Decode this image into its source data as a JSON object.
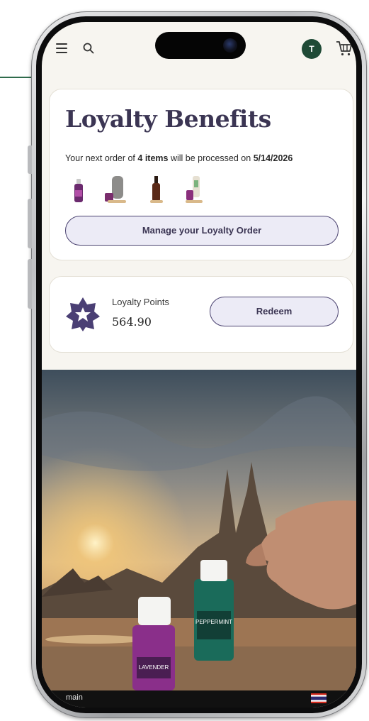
{
  "header": {
    "avatar_initial": "T"
  },
  "loyalty_benefits": {
    "title": "Loyalty Benefits",
    "order_prefix": "Your next order of ",
    "order_items": "4 items",
    "order_middle": " will be processed on ",
    "order_date": "5/14/2026",
    "manage_button": "Manage your Loyalty Order",
    "products": [
      "oil-bottle-purple",
      "diffuser-gray",
      "dropper-bottle-brown",
      "product-bundle"
    ]
  },
  "loyalty_points": {
    "label": "Loyalty Points",
    "value": "564.90",
    "redeem_button": "Redeem"
  },
  "hero": {
    "bottle_left_label": "LAVENDER",
    "bottle_right_label": "PEPPERMINT"
  },
  "bottom_bar": {
    "label": "main"
  },
  "colors": {
    "accent": "#3b3553",
    "brand_green": "#1f4a36",
    "button_bg": "#ecebf6",
    "page_bg": "#f7f5f0"
  }
}
